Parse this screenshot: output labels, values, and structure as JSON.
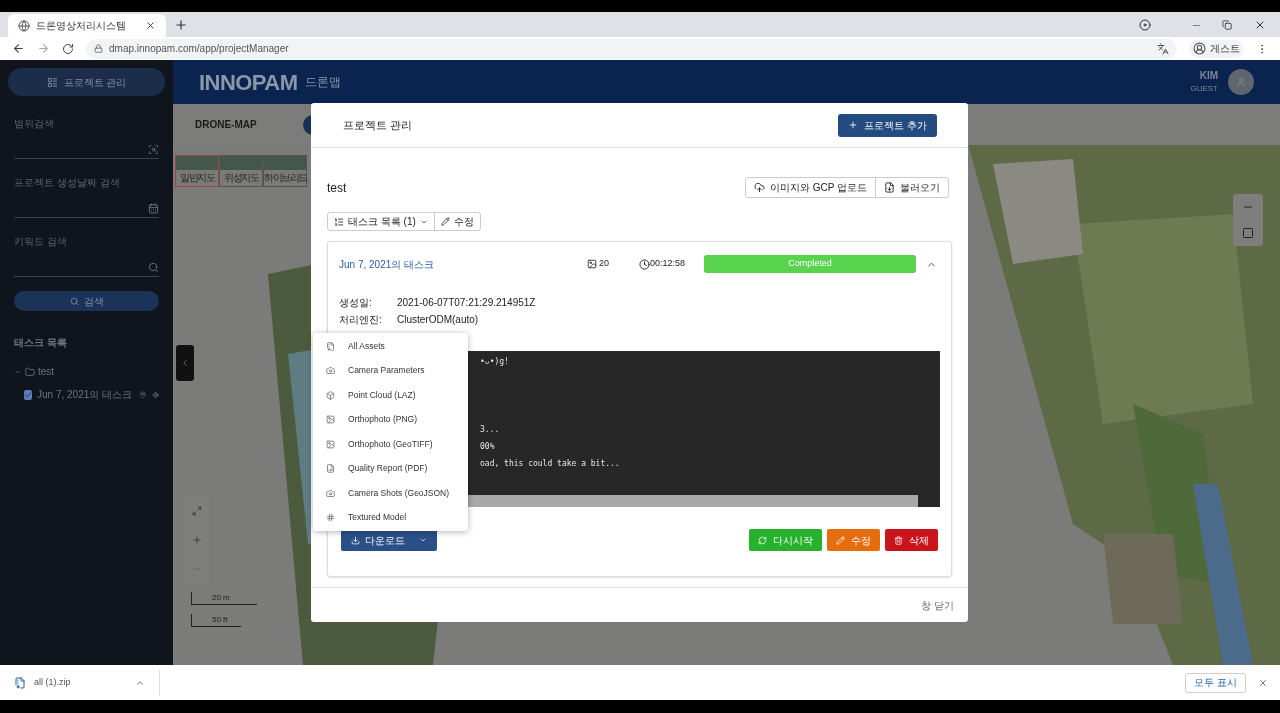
{
  "browser": {
    "tab_title": "드론영상처리시스템",
    "url": "dmap.innopam.com/app/projectManager",
    "profile": "게스트"
  },
  "sidebar": {
    "project_button": "프로젝트 관리",
    "fields": [
      {
        "label": "범위검색",
        "kind": "area"
      },
      {
        "label": "프로젝트 생성날짜 검색",
        "kind": "date"
      },
      {
        "label": "키워드 검색",
        "kind": "search"
      }
    ],
    "search_button": "검색",
    "task_list_title": "태스크 목록",
    "tree": [
      {
        "label": "test",
        "expanded": true,
        "children": [
          {
            "label": "Jun 7, 2021의 태스크",
            "checked": true
          }
        ]
      }
    ]
  },
  "header": {
    "logo": "INNOPAM",
    "app_name": "드론맵",
    "user_name": "KIM",
    "user_role": "GUEST"
  },
  "map": {
    "title": "DRONE-MAP",
    "layers": [
      {
        "label": "일반지도",
        "selected": true
      },
      {
        "label": "위성지도",
        "selected": false
      },
      {
        "label": "하이브리드",
        "selected": false
      }
    ],
    "scale": [
      "20 m",
      "50 ft"
    ]
  },
  "modal": {
    "title": "프로젝트 관리",
    "add_button": "프로젝트 추가",
    "project_name": "test",
    "upload_button": "이미지와 GCP 업로드",
    "import_button": "불러오기",
    "task_list_button": "태스크 목록 (1)",
    "edit_button": "수정",
    "task": {
      "title": "Jun 7, 2021의 태스크",
      "images": "20",
      "duration": "00:12:58",
      "status": "Completed",
      "level": 1,
      "expanded": true,
      "fields": [
        {
          "label": "생성일:",
          "value": "2021-06-07T07:21:29.214951Z"
        },
        {
          "label": "처리엔진:",
          "value": "ClusterODM(auto)"
        }
      ],
      "log": {
        "head": "•ᴗ•)g!",
        "tail": [
          "3...",
          "00%",
          "oad, this could take a bit..."
        ]
      },
      "download": {
        "button": "다운로드",
        "menu": [
          {
            "label": "All Assets"
          },
          {
            "label": "Camera Parameters"
          },
          {
            "label": "Point Cloud (LAZ)"
          },
          {
            "label": "Orthophoto (PNG)"
          },
          {
            "label": "Orthophoto (GeoTIFF)"
          },
          {
            "label": "Quality Report (PDF)"
          },
          {
            "label": "Camera Shots (GeoJSON)"
          },
          {
            "label": "Textured Model"
          }
        ]
      },
      "actions": [
        {
          "label": "다시시작",
          "kind": "restart"
        },
        {
          "label": "수정",
          "kind": "edit"
        },
        {
          "label": "삭제",
          "kind": "delete"
        }
      ]
    },
    "close": "창 닫기"
  },
  "downloads_bar": {
    "file": "all (1).zip",
    "show_all": "모두 표시"
  }
}
